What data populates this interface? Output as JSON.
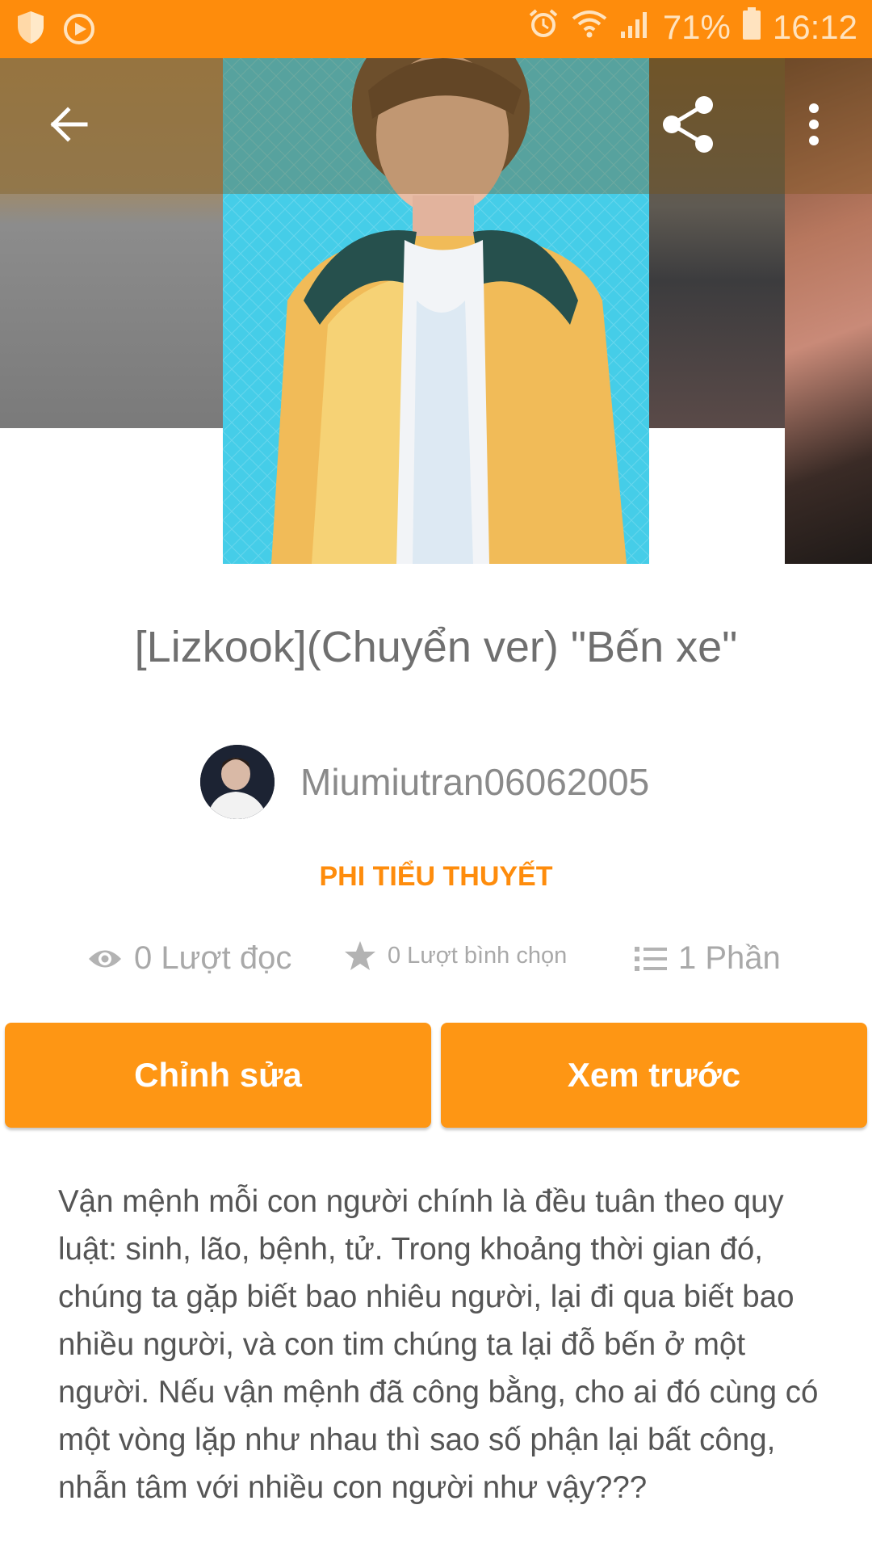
{
  "status_bar": {
    "battery": "71%",
    "time": "16:12",
    "icons": [
      "shield-icon",
      "media-icon",
      "alarm-icon",
      "wifi-icon",
      "signal-icon",
      "battery-icon"
    ]
  },
  "toolbar": {
    "icons": [
      "back-arrow-icon",
      "share-icon",
      "more-vertical-icon"
    ]
  },
  "story": {
    "title": "[Lizkook](Chuyển ver) \"Bến xe\"",
    "author": "Miumiutran06062005",
    "category": "PHI TIỂU THUYẾT",
    "stats": {
      "reads": "0 Lượt đọc",
      "votes": "0 Lượt bình chọn",
      "parts": "1 Phần"
    },
    "description": "Vận mệnh mỗi con người chính là đều tuân theo quy luật: sinh, lão, bệnh, tử. Trong khoảng thời gian đó, chúng ta gặp biết bao nhiêu người, lại đi qua biết bao nhiều người, và con tim chúng ta lại đỗ bến ở một người. Nếu vận mệnh đã công bằng, cho ai đó cùng có một vòng lặp như nhau thì sao số phận lại bất công, nhẫn tâm với nhiều con người như vậy???"
  },
  "actions": {
    "edit_label": "Chỉnh sửa",
    "preview_label": "Xem trước"
  },
  "colors": {
    "accent": "#fe8c0c",
    "button": "#fe9614",
    "title_text": "#6f6f6f",
    "stat_text": "#a9a9a9"
  }
}
